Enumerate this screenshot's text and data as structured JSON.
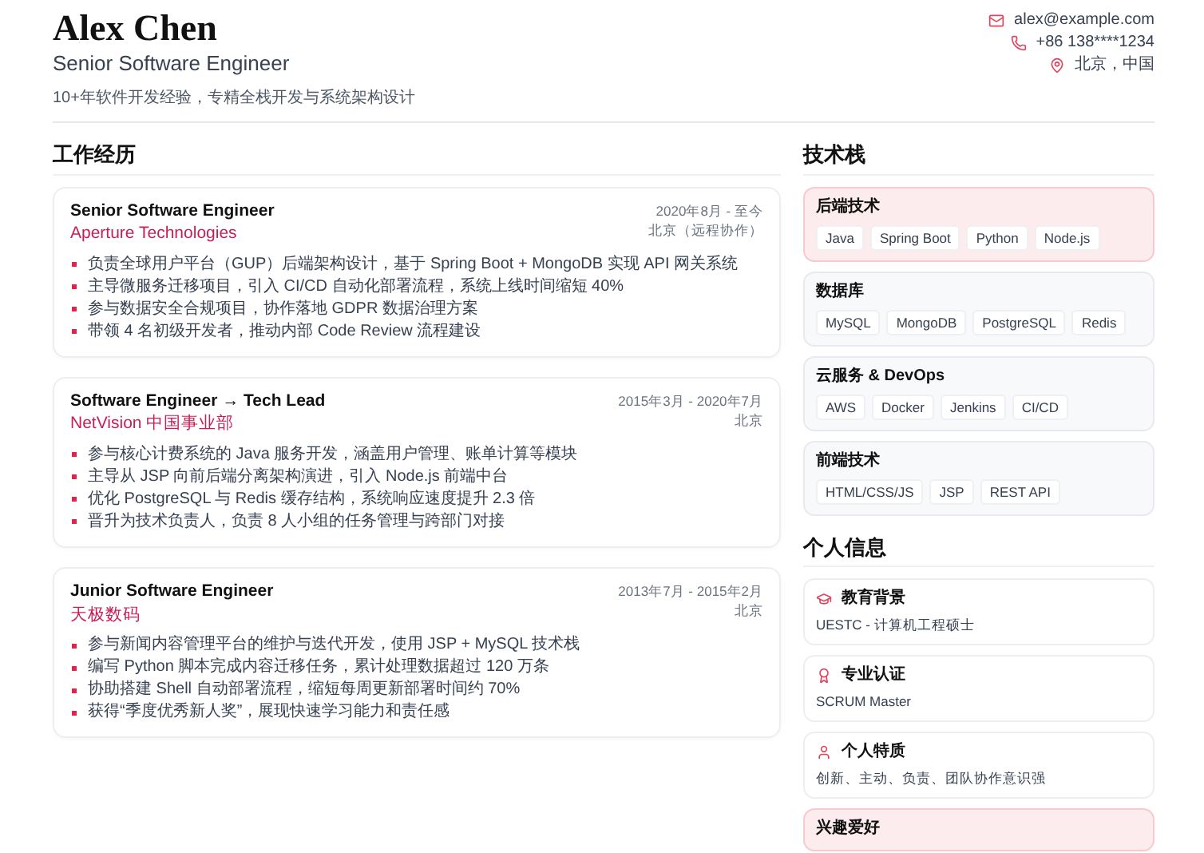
{
  "header": {
    "name": "Alex Chen",
    "title": "Senior Software Engineer",
    "summary": "10+年软件开发经验，专精全栈开发与系统架构设计",
    "contacts": [
      {
        "kind": "email",
        "text": "alex@example.com"
      },
      {
        "kind": "phone",
        "text": "+86 138****1234"
      },
      {
        "kind": "location",
        "text": "北京，中国"
      }
    ]
  },
  "experience": {
    "title": "工作经历",
    "jobs": [
      {
        "role": "Senior Software Engineer",
        "company": "Aperture Technologies",
        "period": "2020年8月 - 至今",
        "location": "北京（远程协作）",
        "bullets": [
          "负责全球用户平台（GUP）后端架构设计，基于 Spring Boot + MongoDB 实现 API 网关系统",
          "主导微服务迁移项目，引入 CI/CD 自动化部署流程，系统上线时间缩短 40%",
          "参与数据安全合规项目，协作落地 GDPR 数据治理方案",
          "带领 4 名初级开发者，推动内部 Code Review 流程建设"
        ]
      },
      {
        "role": "Software Engineer → Tech Lead",
        "company": "NetVision 中国事业部",
        "period": "2015年3月 - 2020年7月",
        "location": "北京",
        "bullets": [
          "参与核心计费系统的 Java 服务开发，涵盖用户管理、账单计算等模块",
          "主导从 JSP 向前后端分离架构演进，引入 Node.js 前端中台",
          "优化 PostgreSQL 与 Redis 缓存结构，系统响应速度提升 2.3 倍",
          "晋升为技术负责人，负责 8 人小组的任务管理与跨部门对接"
        ]
      },
      {
        "role": "Junior Software Engineer",
        "company": "天极数码",
        "period": "2013年7月 - 2015年2月",
        "location": "北京",
        "bullets": [
          "参与新闻内容管理平台的维护与迭代开发，使用 JSP + MySQL 技术栈",
          "编写 Python 脚本完成内容迁移任务，累计处理数据超过 120 万条",
          "协助搭建 Shell 自动部署流程，缩短每周更新部署时间约 70%",
          "获得“季度优秀新人奖”，展现快速学习能力和责任感"
        ]
      }
    ]
  },
  "tech_stack": {
    "title": "技术栈",
    "groups": [
      {
        "name": "后端技术",
        "highlighted": true,
        "tags": [
          "Java",
          "Spring Boot",
          "Python",
          "Node.js"
        ]
      },
      {
        "name": "数据库",
        "highlighted": false,
        "tags": [
          "MySQL",
          "MongoDB",
          "PostgreSQL",
          "Redis"
        ]
      },
      {
        "name": "云服务 & DevOps",
        "highlighted": false,
        "tags": [
          "AWS",
          "Docker",
          "Jenkins",
          "CI/CD"
        ]
      },
      {
        "name": "前端技术",
        "highlighted": false,
        "tags": [
          "HTML/CSS/JS",
          "JSP",
          "REST API"
        ]
      }
    ]
  },
  "personal": {
    "title": "个人信息",
    "items": [
      {
        "kind": "education",
        "label": "教育背景",
        "text": "UESTC - 计算机工程硕士",
        "highlighted": false
      },
      {
        "kind": "certification",
        "label": "专业认证",
        "text": "SCRUM Master",
        "highlighted": false
      },
      {
        "kind": "traits",
        "label": "个人特质",
        "text": "创新、主动、负责、团队协作意识强",
        "highlighted": false
      },
      {
        "kind": "hobbies",
        "label": "兴趣爱好",
        "highlighted": true
      }
    ]
  }
}
